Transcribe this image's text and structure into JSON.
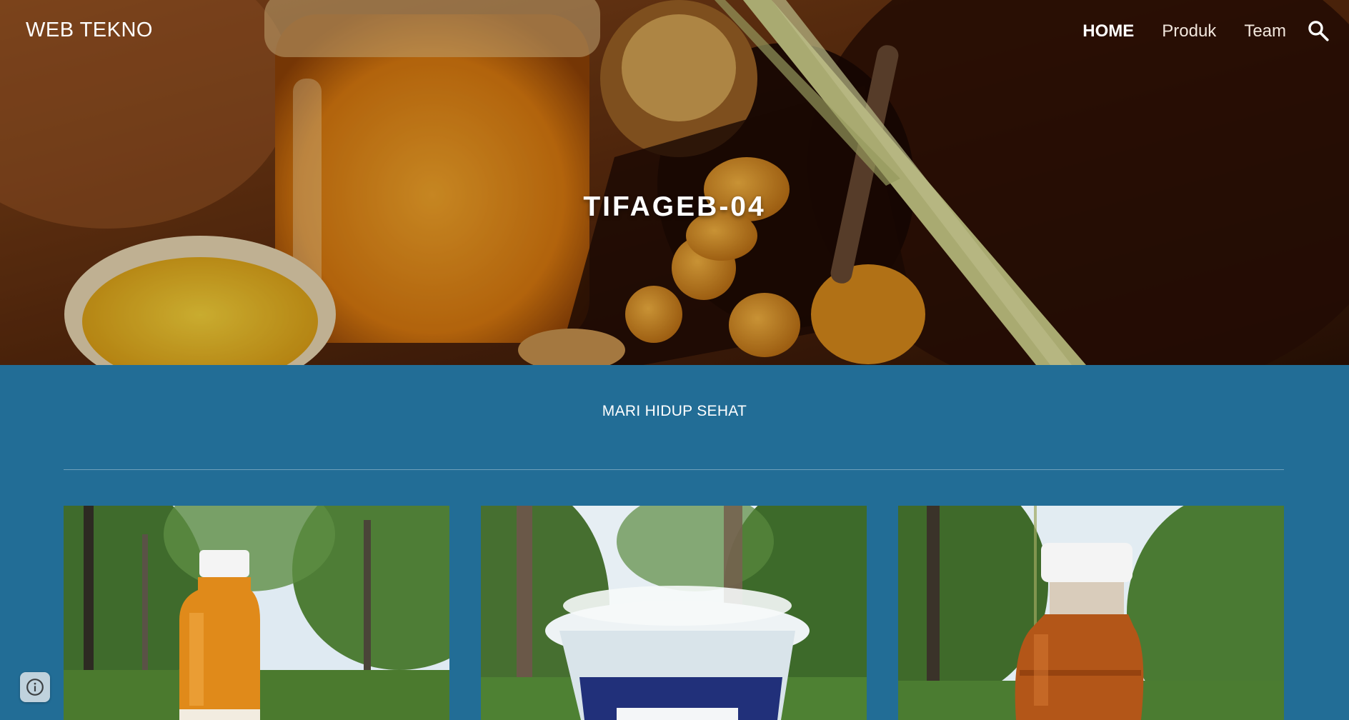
{
  "header": {
    "site_title": "WEB TEKNO",
    "nav_items": [
      {
        "label": "HOME",
        "active": true
      },
      {
        "label": "Produk",
        "active": false
      },
      {
        "label": "Team",
        "active": false
      }
    ],
    "search_icon": "search-icon"
  },
  "hero": {
    "title": "TIFAGEB-04",
    "image": "turmeric-drink-photo"
  },
  "main": {
    "tagline": "MARI HIDUP SEHAT",
    "products": [
      {
        "image": "turmeric-bottle-photo"
      },
      {
        "image": "blue-drink-cup-photo"
      },
      {
        "image": "brown-drink-bottle-photo"
      }
    ]
  },
  "footer": {
    "info_icon": "info-icon"
  },
  "colors": {
    "section_background": "#226d96",
    "text": "#ffffff"
  }
}
